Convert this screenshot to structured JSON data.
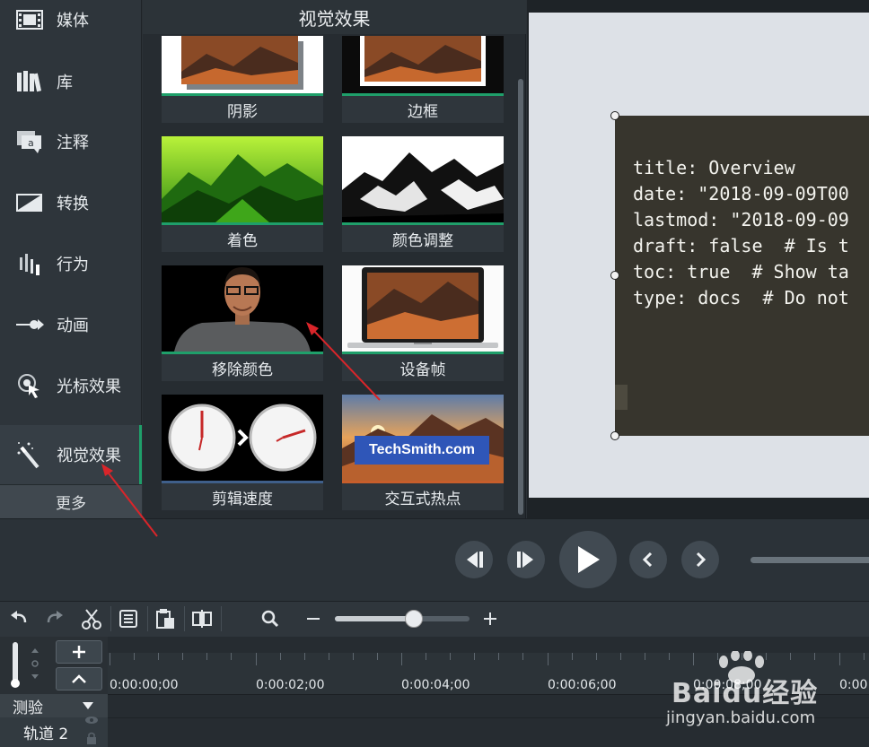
{
  "sidebar": {
    "items": [
      {
        "label": "媒体",
        "icon": "film-icon"
      },
      {
        "label": "库",
        "icon": "library-books-icon"
      },
      {
        "label": "注释",
        "icon": "annotation-bubble-icon"
      },
      {
        "label": "转换",
        "icon": "transition-icon"
      },
      {
        "label": "行为",
        "icon": "behavior-icon"
      },
      {
        "label": "动画",
        "icon": "animation-arrow-icon"
      },
      {
        "label": "光标效果",
        "icon": "cursor-effect-icon"
      },
      {
        "label": "视觉效果",
        "icon": "magic-wand-icon",
        "active": true
      }
    ],
    "more_label": "更多"
  },
  "panel": {
    "title": "视觉效果",
    "tiles": [
      {
        "label": "阴影"
      },
      {
        "label": "边框"
      },
      {
        "label": "着色"
      },
      {
        "label": "颜色调整"
      },
      {
        "label": "移除颜色"
      },
      {
        "label": "设备帧"
      },
      {
        "label": "剪辑速度"
      },
      {
        "label": "交互式热点",
        "overlay_text": "TechSmith.com"
      }
    ]
  },
  "canvas": {
    "doc_lines": [
      "title: Overview",
      "date: \"2018-09-09T00",
      "lastmod: \"2018-09-09",
      "draft: false  # Is t",
      "toc: true  # Show ta",
      "type: docs  # Do not"
    ]
  },
  "playback": {
    "buttons": [
      "step-back-icon",
      "step-forward-icon",
      "play-icon",
      "previous-icon",
      "next-icon"
    ]
  },
  "timeline": {
    "toolbar_icons": [
      "undo-icon",
      "redo-icon",
      "cut-icon",
      "copy-icon",
      "paste-icon",
      "split-icon",
      "zoom-icon",
      "zoom-out-icon",
      "zoom-in-icon"
    ],
    "zoom_level": 0.58,
    "times": [
      "0:00:00;00",
      "0:00:02;00",
      "0:00:04;00",
      "0:00:06;00",
      "0:00:08;00",
      "0:00"
    ],
    "tracks": [
      {
        "name": "测验"
      },
      {
        "name": "轨道 2"
      }
    ]
  },
  "watermark": {
    "main": "Baidu经验",
    "sub": "jingyan.baidu.com"
  },
  "colors": {
    "accent": "#1f9f6a",
    "arrow": "#d9252a"
  }
}
